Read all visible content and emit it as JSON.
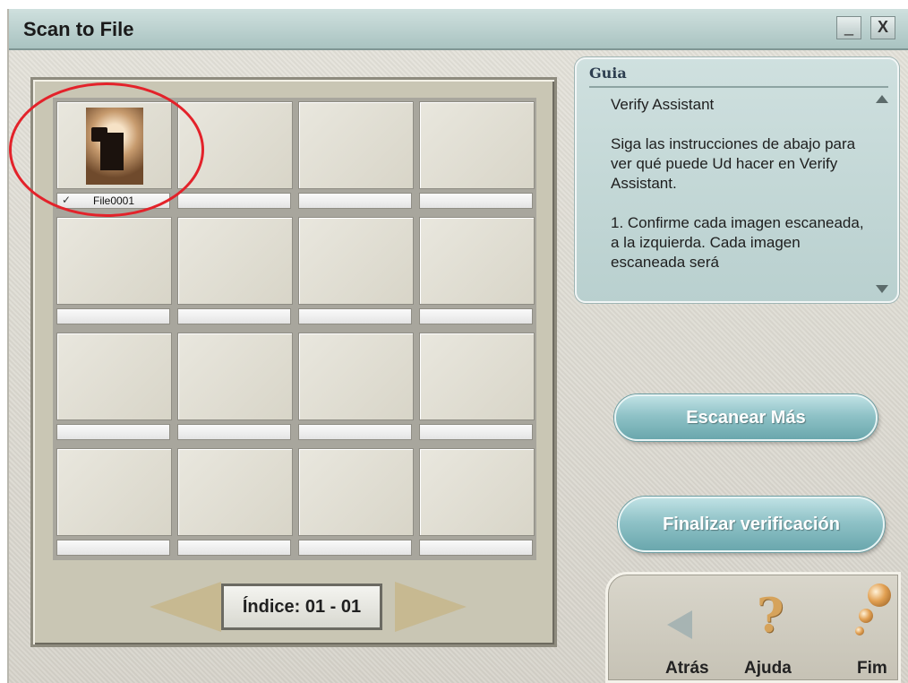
{
  "window": {
    "title": "Scan to File",
    "minimize_label": "_",
    "close_label": "X"
  },
  "grid": {
    "files": [
      {
        "name": "File0001",
        "checked": true,
        "check_mark": "✓"
      }
    ],
    "rows": 4,
    "columns": 4
  },
  "navigation": {
    "index_label": "Índice: 01 - 01"
  },
  "guide": {
    "title": "Guia",
    "heading": "Verify Assistant",
    "paragraph1": "Siga las instrucciones de abajo para ver qué puede Ud hacer en Verify Assistant.",
    "paragraph2": "1. Confirme cada imagen escaneada, a la izquierda. Cada imagen escaneada será"
  },
  "buttons": {
    "scan_more": "Escanear Más",
    "finish_verification": "Finalizar verificación"
  },
  "bottom_nav": {
    "back": "Atrás",
    "help": "Ajuda",
    "end": "Fim"
  },
  "colors": {
    "annotation": "#e3222a",
    "accent_teal": "#8fc2c7",
    "title_bar": "#a9c3c1"
  }
}
